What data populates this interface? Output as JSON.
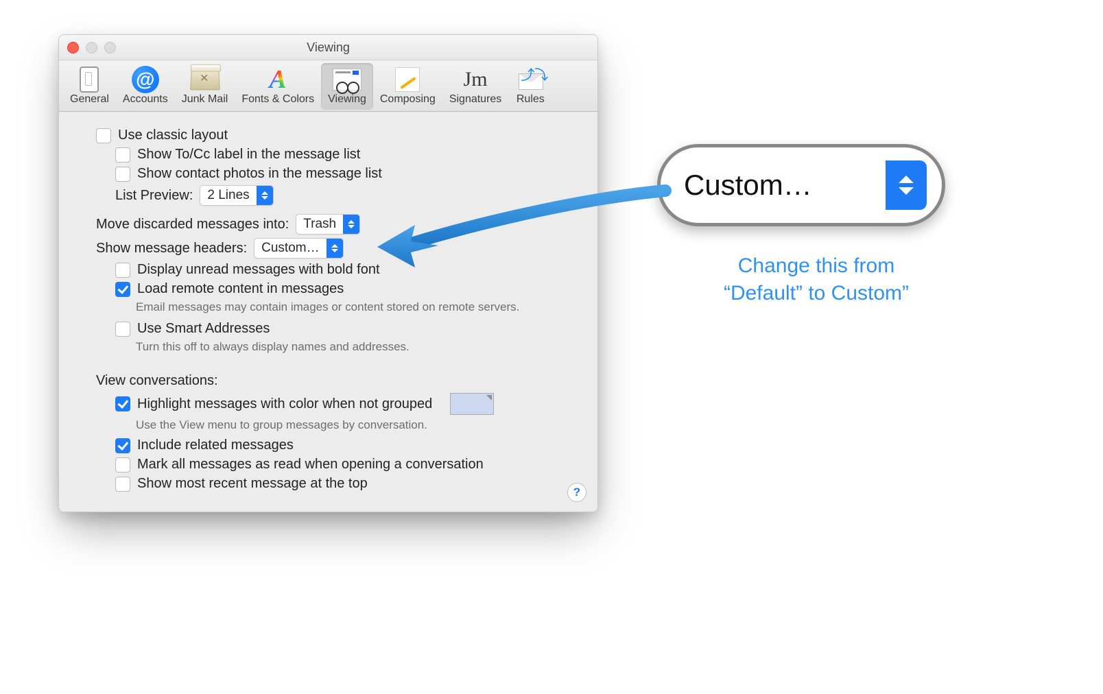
{
  "window": {
    "title": "Viewing"
  },
  "toolbar": {
    "items": [
      {
        "label": "General"
      },
      {
        "label": "Accounts"
      },
      {
        "label": "Junk Mail"
      },
      {
        "label": "Fonts & Colors"
      },
      {
        "label": "Viewing"
      },
      {
        "label": "Composing"
      },
      {
        "label": "Signatures"
      },
      {
        "label": "Rules"
      }
    ],
    "selected_index": 4
  },
  "options": {
    "use_classic_layout": "Use classic layout",
    "show_to_cc": "Show To/Cc label in the message list",
    "show_contact_photos": "Show contact photos in the message list",
    "list_preview_label": "List Preview:",
    "list_preview_value": "2 Lines",
    "move_discarded_label": "Move discarded messages into:",
    "move_discarded_value": "Trash",
    "show_headers_label": "Show message headers:",
    "show_headers_value": "Custom…",
    "display_unread_bold": "Display unread messages with bold font",
    "load_remote": "Load remote content in messages",
    "load_remote_hint": "Email messages may contain images or content stored on remote servers.",
    "use_smart_addresses": "Use Smart Addresses",
    "use_smart_hint": "Turn this off to always display names and addresses.",
    "view_conversations_title": "View conversations:",
    "highlight_color": "Highlight messages with color when not grouped",
    "highlight_hint": "Use the View menu to group messages by conversation.",
    "include_related": "Include related messages",
    "mark_all_read": "Mark all messages as read when opening a conversation",
    "show_recent_top": "Show most recent message at the top"
  },
  "callout": {
    "value": "Custom…"
  },
  "note": {
    "line1": "Change this from",
    "line2": "“Default” to Custom”"
  },
  "help": "?"
}
